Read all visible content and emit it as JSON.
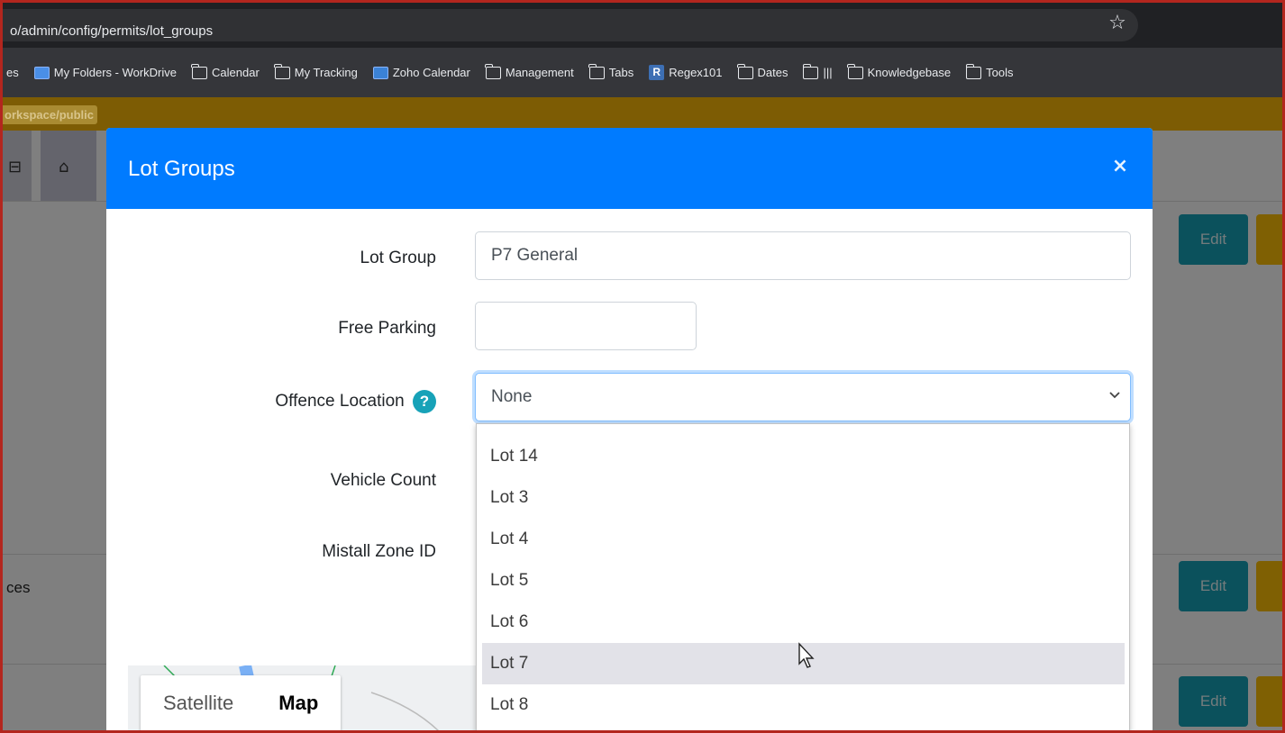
{
  "browser": {
    "url": "o/admin/config/permits/lot_groups",
    "bookmarks": [
      {
        "label": "es",
        "icon": "none"
      },
      {
        "label": "My Folders - WorkDrive",
        "icon": "app"
      },
      {
        "label": "Calendar",
        "icon": "folder"
      },
      {
        "label": "My Tracking",
        "icon": "folder"
      },
      {
        "label": "Zoho Calendar",
        "icon": "cal"
      },
      {
        "label": "Management",
        "icon": "folder"
      },
      {
        "label": "Tabs",
        "icon": "folder"
      },
      {
        "label": "Regex101",
        "icon": "r"
      },
      {
        "label": "Dates",
        "icon": "folder"
      },
      {
        "label": "|||",
        "icon": "folder"
      },
      {
        "label": "Knowledgebase",
        "icon": "folder"
      },
      {
        "label": "Tools",
        "icon": "folder"
      }
    ],
    "env_tag": "orkspace/public"
  },
  "background": {
    "row1_text": "",
    "row2_text": "ces",
    "edit_label": "Edit"
  },
  "modal": {
    "title": "Lot Groups",
    "close": "×",
    "fields": {
      "lot_group": {
        "label": "Lot Group",
        "value": "P7 General"
      },
      "free_parking": {
        "label": "Free Parking",
        "value": ""
      },
      "offence_location": {
        "label": "Offence Location",
        "value": "None",
        "help": "?"
      },
      "vehicle_count": {
        "label": "Vehicle Count"
      },
      "mistall_zone": {
        "label": "Mistall Zone ID"
      }
    },
    "map_toggle": {
      "satellite": "Satellite",
      "map": "Map"
    }
  },
  "dropdown": {
    "options": [
      "Lot 14",
      "Lot 3",
      "Lot 4",
      "Lot 5",
      "Lot 6",
      "Lot 7",
      "Lot 8"
    ],
    "hovered": "Lot 7"
  },
  "colors": {
    "header": "#007bff",
    "edit_button": "#17a2b8",
    "warning_button": "#ffc107",
    "env_bar": "#7d5c04"
  }
}
